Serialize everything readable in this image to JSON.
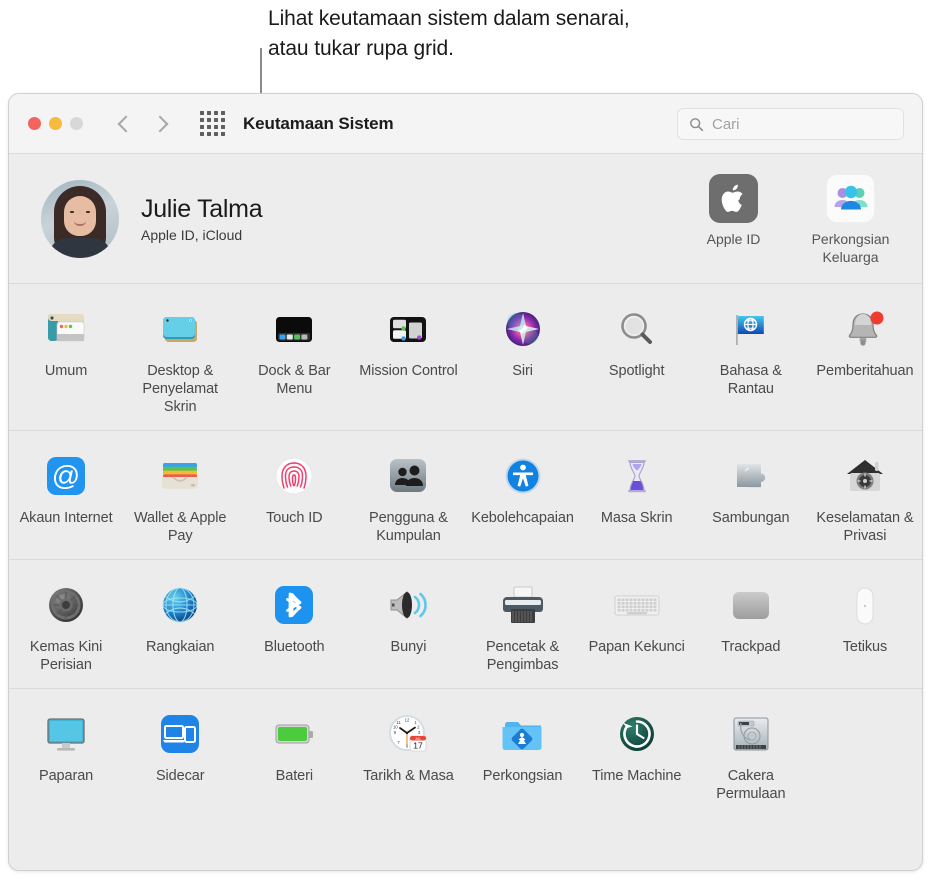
{
  "callout": {
    "line1": "Lihat keutamaan sistem dalam senarai,",
    "line2": "atau tukar rupa grid."
  },
  "window": {
    "title": "Keutamaan Sistem",
    "traffic_lights": [
      "close",
      "minimize",
      "zoom"
    ],
    "nav": {
      "back": "‹",
      "forward": "›"
    },
    "grid_button_name": "Grid"
  },
  "search": {
    "placeholder": "Cari",
    "value": ""
  },
  "account": {
    "name": "Julie Talma",
    "subtitle": "Apple ID, iCloud",
    "tiles": [
      {
        "label": "Apple ID",
        "icon": "apple-logo-icon"
      },
      {
        "label": "Perkongsian Keluarga",
        "icon": "family-sharing-icon"
      }
    ]
  },
  "sections": [
    {
      "id": "section-1",
      "items": [
        {
          "label": "Umum",
          "icon": "general-window-icon"
        },
        {
          "label": "Desktop & Penyelamat Skrin",
          "icon": "desktop-screensaver-icon"
        },
        {
          "label": "Dock & Bar Menu",
          "icon": "dock-menubar-icon"
        },
        {
          "label": "Mission Control",
          "icon": "mission-control-icon"
        },
        {
          "label": "Siri",
          "icon": "siri-icon"
        },
        {
          "label": "Spotlight",
          "icon": "spotlight-magnifier-icon"
        },
        {
          "label": "Bahasa & Rantau",
          "icon": "language-region-flag-icon"
        },
        {
          "label": "Pemberitahuan",
          "icon": "notifications-bell-icon"
        }
      ]
    },
    {
      "id": "section-2",
      "items": [
        {
          "label": "Akaun Internet",
          "icon": "internet-accounts-at-icon"
        },
        {
          "label": "Wallet & Apple Pay",
          "icon": "wallet-icon"
        },
        {
          "label": "Touch ID",
          "icon": "touch-id-fingerprint-icon"
        },
        {
          "label": "Pengguna & Kumpulan",
          "icon": "users-groups-icon"
        },
        {
          "label": "Kebolehcapaian",
          "icon": "accessibility-icon"
        },
        {
          "label": "Masa Skrin",
          "icon": "screen-time-hourglass-icon"
        },
        {
          "label": "Sambungan",
          "icon": "extensions-puzzle-icon"
        },
        {
          "label": "Keselamatan & Privasi",
          "icon": "security-privacy-house-icon"
        }
      ]
    },
    {
      "id": "section-3",
      "items": [
        {
          "label": "Kemas Kini Perisian",
          "icon": "software-update-gear-icon"
        },
        {
          "label": "Rangkaian",
          "icon": "network-globe-icon"
        },
        {
          "label": "Bluetooth",
          "icon": "bluetooth-icon"
        },
        {
          "label": "Bunyi",
          "icon": "sound-speaker-icon"
        },
        {
          "label": "Pencetak & Pengimbas",
          "icon": "printers-scanners-icon"
        },
        {
          "label": "Papan Kekunci",
          "icon": "keyboard-icon"
        },
        {
          "label": "Trackpad",
          "icon": "trackpad-icon"
        },
        {
          "label": "Tetikus",
          "icon": "mouse-icon"
        }
      ]
    },
    {
      "id": "section-4",
      "items": [
        {
          "label": "Paparan",
          "icon": "displays-monitor-icon"
        },
        {
          "label": "Sidecar",
          "icon": "sidecar-icon"
        },
        {
          "label": "Bateri",
          "icon": "battery-icon"
        },
        {
          "label": "Tarikh & Masa",
          "icon": "date-time-clock-icon"
        },
        {
          "label": "Perkongsian",
          "icon": "sharing-folder-icon"
        },
        {
          "label": "Time Machine",
          "icon": "time-machine-icon"
        },
        {
          "label": "Cakera Permulaan",
          "icon": "startup-disk-icon"
        }
      ]
    }
  ],
  "colors": {
    "window_bg": "#ececec",
    "titlebar_bg": "#f4f4f4",
    "close": "#f4645f",
    "minimize": "#f6bb3e",
    "zoom": "#d8d8d8",
    "label": "#4a4a4a",
    "accent_blue": "#1e8bf0"
  }
}
